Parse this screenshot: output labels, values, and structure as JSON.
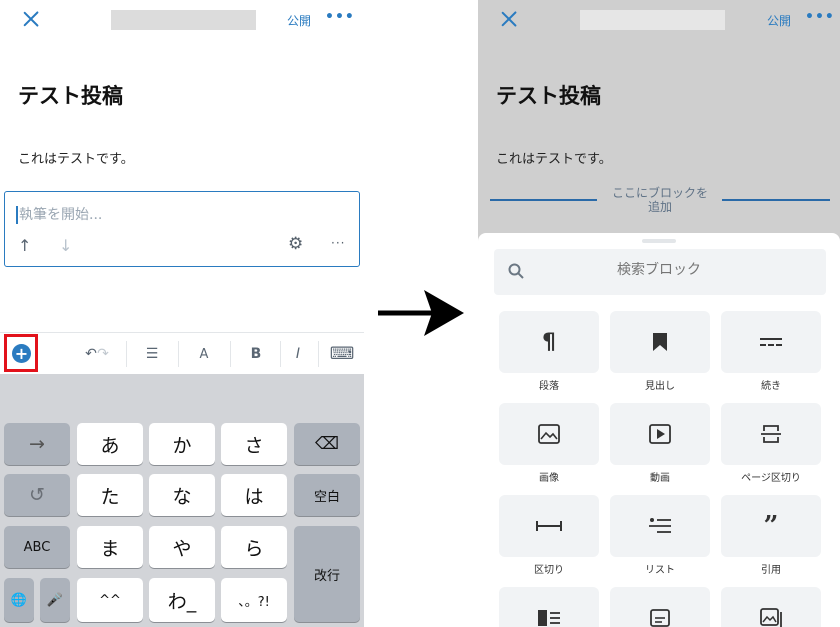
{
  "left_screen": {
    "header": {
      "publish_label": "公開",
      "more_label": "•••"
    },
    "post": {
      "title": "テスト投稿",
      "body": "これはテストです。"
    },
    "editor": {
      "placeholder": "執筆を開始...",
      "up_arrow": "↑",
      "down_arrow": "↓",
      "settings_icon": "⚙",
      "more_label": "···"
    },
    "format_bar": {
      "add_icon": "+",
      "undo_icon": "↶",
      "redo_icon": "↷",
      "align_icon": "☰",
      "text_label": "A",
      "bold_label": "B",
      "italic_label": "I",
      "keyboard_icon": "⌨"
    },
    "keyboard": {
      "row1": [
        "→",
        "あ",
        "か",
        "さ",
        "⌫"
      ],
      "row2": [
        "↺",
        "た",
        "な",
        "は",
        "空白"
      ],
      "row3": [
        "ABC",
        "ま",
        "や",
        "ら",
        "改行"
      ],
      "row4": [
        "🌐",
        "🎤",
        "^^",
        "わ_",
        "、。?!"
      ]
    }
  },
  "right_screen": {
    "header": {
      "publish_label": "公開",
      "more_label": "•••"
    },
    "post": {
      "title": "テスト投稿",
      "body": "これはテストです。"
    },
    "add_block_here": "ここにブロックを\n追加",
    "search": {
      "placeholder": "検索ブロック"
    },
    "blocks": [
      {
        "label": "段落",
        "icon": "¶"
      },
      {
        "label": "見出し",
        "icon": "bookmark"
      },
      {
        "label": "続き",
        "icon": "more"
      },
      {
        "label": "画像",
        "icon": "image"
      },
      {
        "label": "動画",
        "icon": "video"
      },
      {
        "label": "ページ区切り",
        "icon": "page-break"
      },
      {
        "label": "区切り",
        "icon": "separator"
      },
      {
        "label": "リスト",
        "icon": "list"
      },
      {
        "label": "引用",
        "icon": "quote"
      }
    ]
  },
  "colors": {
    "accent": "#2a7bc0",
    "highlight": "#e2121b",
    "keyboard_bg": "#d2d4d8"
  }
}
